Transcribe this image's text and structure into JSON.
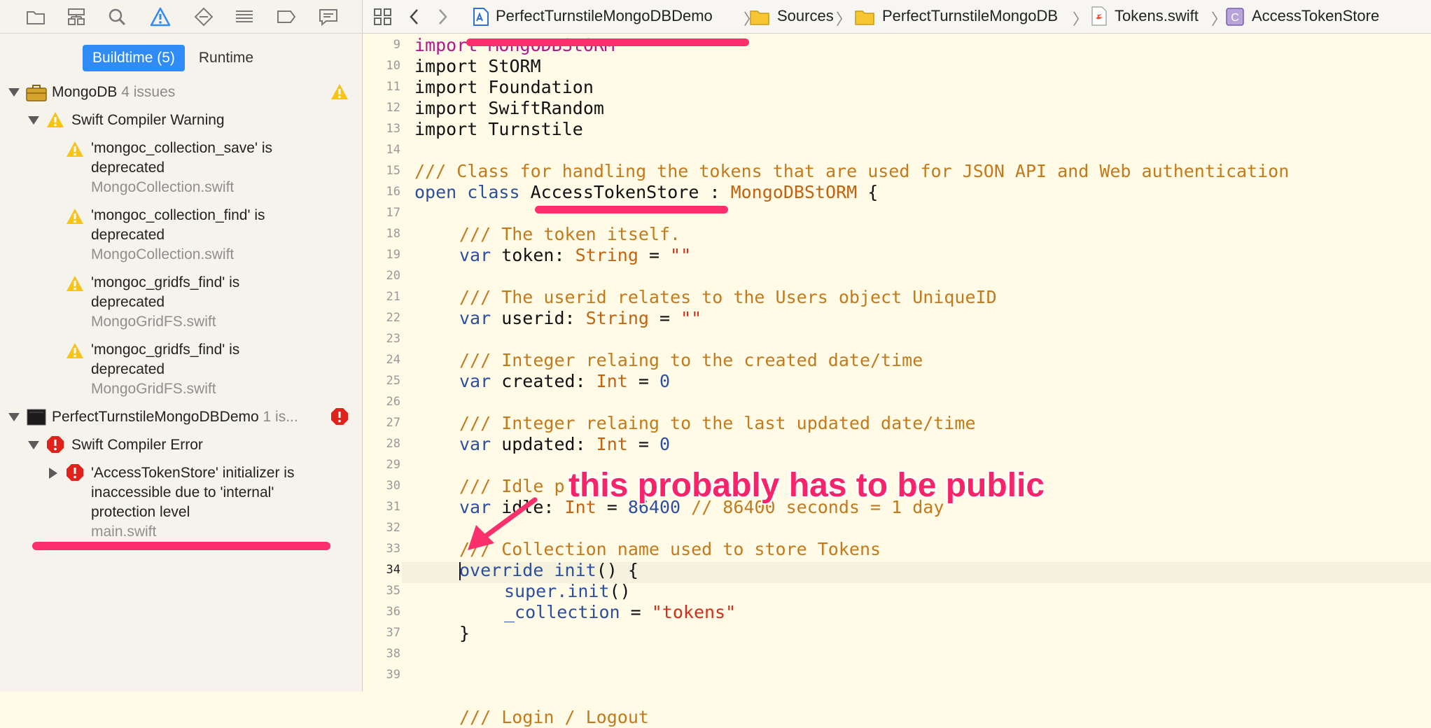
{
  "navigator": {
    "toolbar_icons": [
      "folder-icon",
      "hierarchy-icon",
      "search-icon",
      "warning-icon",
      "breakpoint-diamond-icon",
      "list-icon",
      "tag-icon",
      "comment-icon"
    ],
    "segments": [
      {
        "label": "Buildtime (5)",
        "active": true
      },
      {
        "label": "Runtime",
        "active": false
      }
    ],
    "groups": [
      {
        "name": "MongoDB",
        "count": "4 issues",
        "category": "Swift Compiler Warning",
        "issues": [
          {
            "line1": "'mongoc_collection_save' is",
            "line2": "deprecated",
            "file": "MongoCollection.swift"
          },
          {
            "line1": "'mongoc_collection_find' is",
            "line2": "deprecated",
            "file": "MongoCollection.swift"
          },
          {
            "line1": "'mongoc_gridfs_find' is",
            "line2": "deprecated",
            "file": "MongoGridFS.swift"
          },
          {
            "line1": "'mongoc_gridfs_find' is",
            "line2": "deprecated",
            "file": "MongoGridFS.swift"
          }
        ]
      },
      {
        "name": "PerfectTurnstileMongoDBDemo",
        "count": "1 is...",
        "category": "Swift Compiler Error",
        "issues": [
          {
            "line1": "'AccessTokenStore' initializer is",
            "line2": "inaccessible due to 'internal'",
            "line3": "protection level",
            "file": "main.swift"
          }
        ]
      }
    ]
  },
  "jumpbar": {
    "crumbs": [
      "PerfectTurnstileMongoDBDemo",
      "Sources",
      "PerfectTurnstileMongoDB",
      "Tokens.swift",
      "AccessTokenStore"
    ]
  },
  "editor": {
    "line_numbers": [
      "9",
      "10",
      "11",
      "12",
      "13",
      "14",
      "15",
      "16",
      "17",
      "18",
      "19",
      "20",
      "21",
      "22",
      "23",
      "24",
      "25",
      "26",
      "27",
      "28",
      "29",
      "30",
      "31",
      "32",
      "33",
      "34",
      "35",
      "36",
      "37",
      "38",
      "39"
    ],
    "current_line": "34",
    "code": {
      "l9": "import MongoDBStORM",
      "l10": "import StORM",
      "l11": "import Foundation",
      "l12": "import SwiftRandom",
      "l13": "import Turnstile",
      "l15": "/// Class for handling the tokens that are used for JSON API and Web authentication",
      "l16_kw": "open class",
      "l16_name": "AccessTokenStore",
      "l16_sep": " : ",
      "l16_super": "MongoDBStORM",
      "l16_end": " {",
      "l18": "/// The token itself.",
      "l19_var": "var",
      "l19_name": " token: ",
      "l19_type": "String",
      "l19_eq": " = ",
      "l19_val": "\"\"",
      "l21": "/// The userid relates to the Users object UniqueID",
      "l22_var": "var",
      "l22_name": " userid: ",
      "l22_type": "String",
      "l22_eq": " = ",
      "l22_val": "\"\"",
      "l24": "/// Integer relaing to the created date/time",
      "l25_var": "var",
      "l25_name": " created: ",
      "l25_type": "Int",
      "l25_eq": " = ",
      "l25_val": "0",
      "l27": "/// Integer relaing to the last updated date/time",
      "l28_var": "var",
      "l28_name": " updated: ",
      "l28_type": "Int",
      "l28_eq": " = ",
      "l28_val": "0",
      "l30": "/// Idle p",
      "l31_var": "var",
      "l31_name": " idle: ",
      "l31_type": "Int",
      "l31_eq": " = ",
      "l31_val": "86400",
      "l31_cm": " // 86400 seconds = 1 day",
      "l33": "/// Collection name used to store Tokens",
      "l34_kw": "override",
      "l34_kw2": " init",
      "l34_end": "() {",
      "l35_a": "super",
      "l35_b": ".init",
      "l35_c": "()",
      "l36_a": "_collection",
      "l36_b": " = ",
      "l36_c": "\"tokens\"",
      "l37": "}",
      "l40": "/// Login / Logout "
    }
  },
  "annotation": {
    "text": "this probably has to be public"
  },
  "colors": {
    "accent": "#2f8cf6",
    "annotation": "#fb2f6c",
    "warning": "#f7c317",
    "error": "#e0221b"
  }
}
